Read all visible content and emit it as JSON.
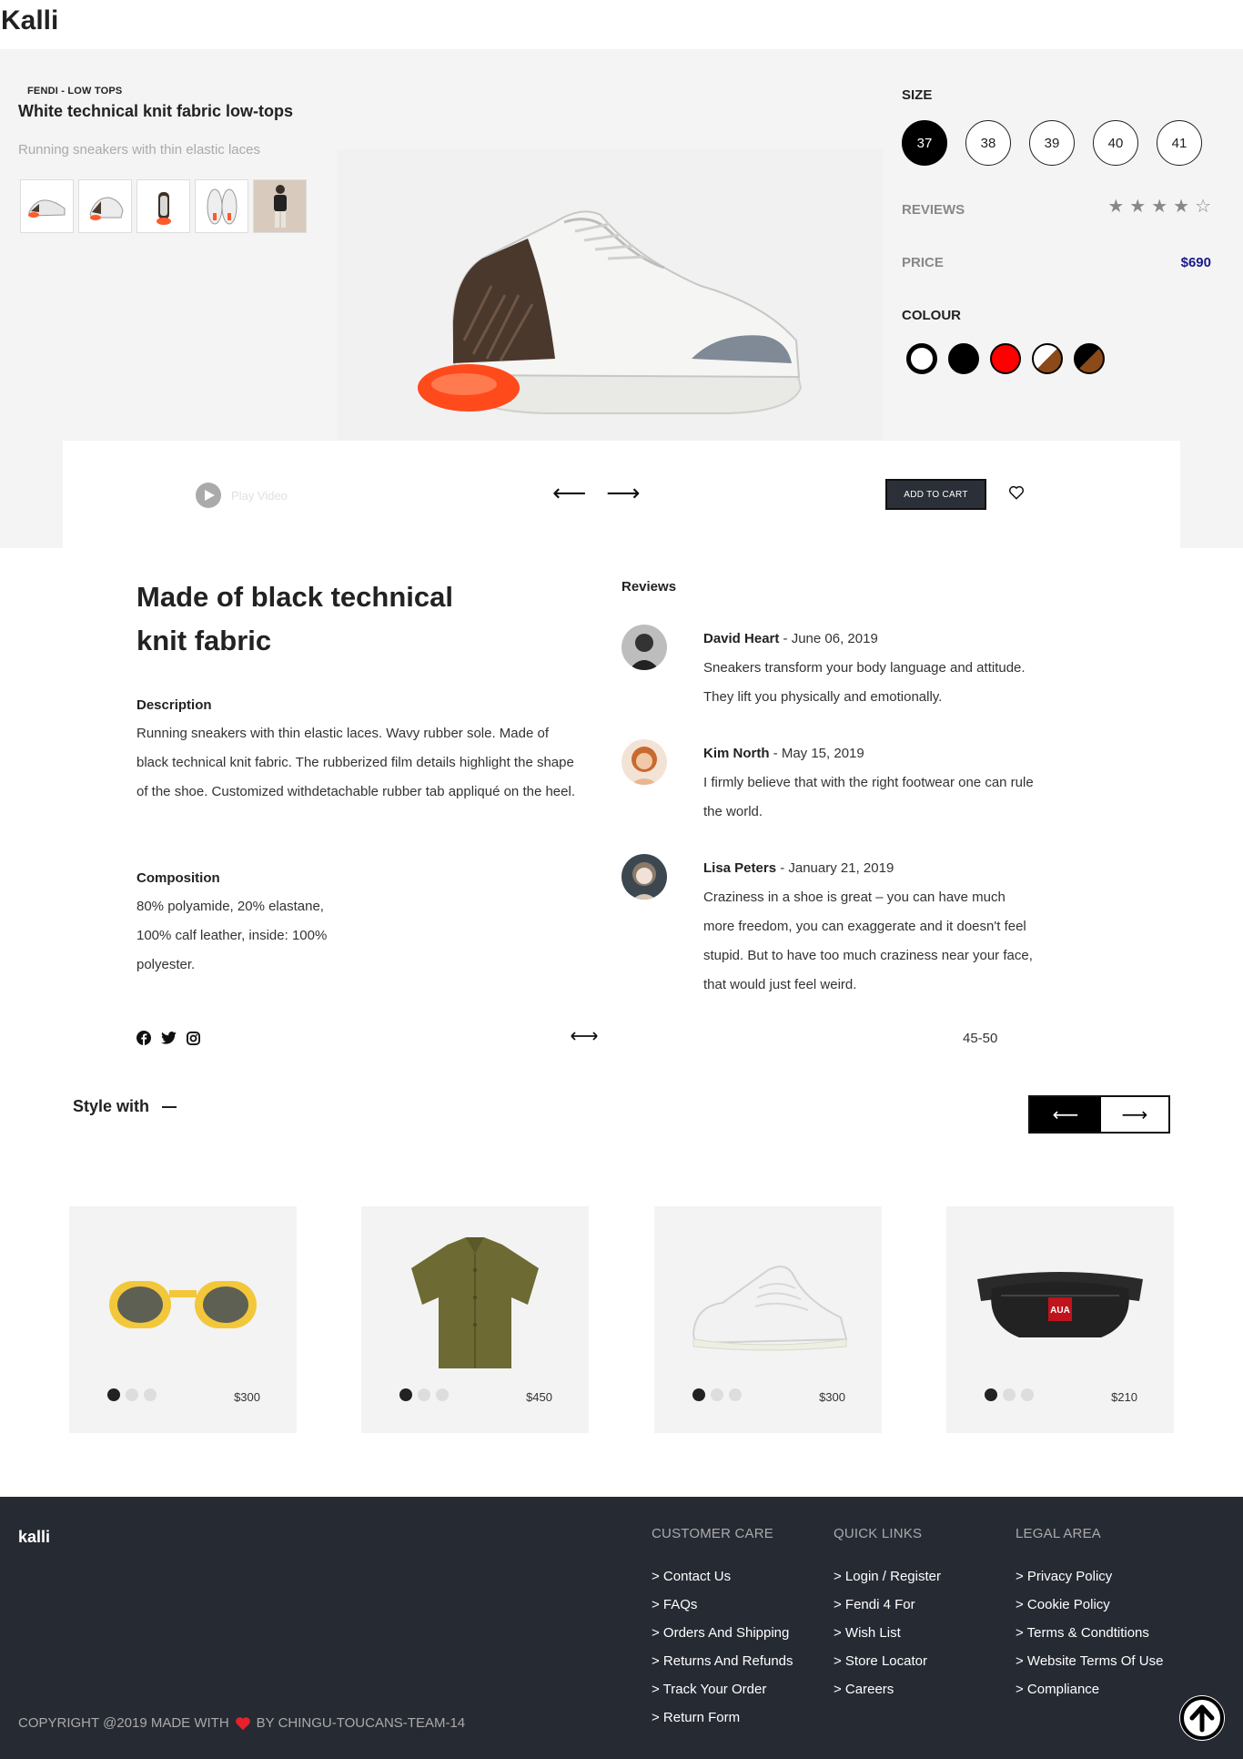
{
  "header": {
    "brand": "Kalli"
  },
  "product": {
    "breadcrumb": "FENDI - LOW TOPS",
    "title": "White technical knit fabric low-tops",
    "subtitle": "Running sneakers with thin elastic laces",
    "thumbnails": [
      "shoe-side-thumb",
      "shoe-angle-thumb",
      "shoe-back-thumb",
      "shoe-top-thumb",
      "model-thumb"
    ]
  },
  "options": {
    "size_label": "SIZE",
    "sizes": [
      "37",
      "38",
      "39",
      "40",
      "41"
    ],
    "selected_size": "37",
    "reviews_label": "REVIEWS",
    "rating": 4,
    "rating_max": 5,
    "price_label": "PRICE",
    "price": "$690",
    "colour_label": "COLOUR",
    "colours": [
      "#ffffff",
      "#000000",
      "#ff0000",
      "white-brown",
      "black-brown"
    ]
  },
  "actions": {
    "play_label": "Play Video",
    "add_to_cart": "ADD TO CART"
  },
  "details": {
    "heading": "Made of black technical knit fabric",
    "description_label": "Description",
    "description": "Running sneakers with thin elastic laces. Wavy rubber sole. Made of black technical knit fabric. The rubberized film details highlight the shape of the shoe. Customized withdetachable rubber tab appliqué on the heel.",
    "composition_label": "Composition",
    "composition": "80% polyamide, 20% elastane, 100% calf leather, inside: 100% polyester.",
    "range": "45-50"
  },
  "reviews": {
    "title": "Reviews",
    "items": [
      {
        "name": "David Heart",
        "date": " - June 06, 2019",
        "text": "Sneakers transform your body language and attitude. They lift you physically and emotionally."
      },
      {
        "name": "Kim North",
        "date": " - May 15, 2019",
        "text": "I firmly believe that with the right footwear one can rule the world."
      },
      {
        "name": "Lisa Peters",
        "date": " - January 21, 2019",
        "text": "Craziness in a shoe is great – you can have much more freedom, you can exaggerate and it doesn't feel stupid. But to have too much craziness near your face, that would just feel weird."
      }
    ]
  },
  "style_with": {
    "title": "Style with",
    "products": [
      {
        "price": "$300",
        "icon": "sunglasses-icon"
      },
      {
        "price": "$450",
        "icon": "shirt-icon"
      },
      {
        "price": "$300",
        "icon": "sneaker-icon"
      },
      {
        "price": "$210",
        "icon": "belt-bag-icon"
      }
    ]
  },
  "footer": {
    "logo": "kalli",
    "columns": [
      {
        "title": "CUSTOMER CARE",
        "links": [
          "> Contact Us",
          "> FAQs",
          "> Orders And Shipping",
          "> Returns And Refunds",
          "> Track Your Order",
          "> Return Form"
        ]
      },
      {
        "title": "QUICK LINKS",
        "links": [
          "> Login / Register",
          "> Fendi 4 For",
          "> Wish List",
          "> Store Locator",
          "> Careers"
        ]
      },
      {
        "title": "LEGAL AREA",
        "links": [
          "> Privacy Policy",
          "> Cookie Policy",
          "> Terms & Condtitions",
          "> Website Terms Of Use",
          "> Compliance"
        ]
      }
    ],
    "copyright_prefix": "COPYRIGHT @2019 MADE WITH",
    "copyright_suffix": "BY CHINGU-TOUCANS-TEAM-14"
  },
  "colors": {
    "accent": "#2b2f38",
    "price": "#1a1a8a",
    "footer_bg": "#262a33",
    "hero_bg": "#f4f4f4"
  }
}
